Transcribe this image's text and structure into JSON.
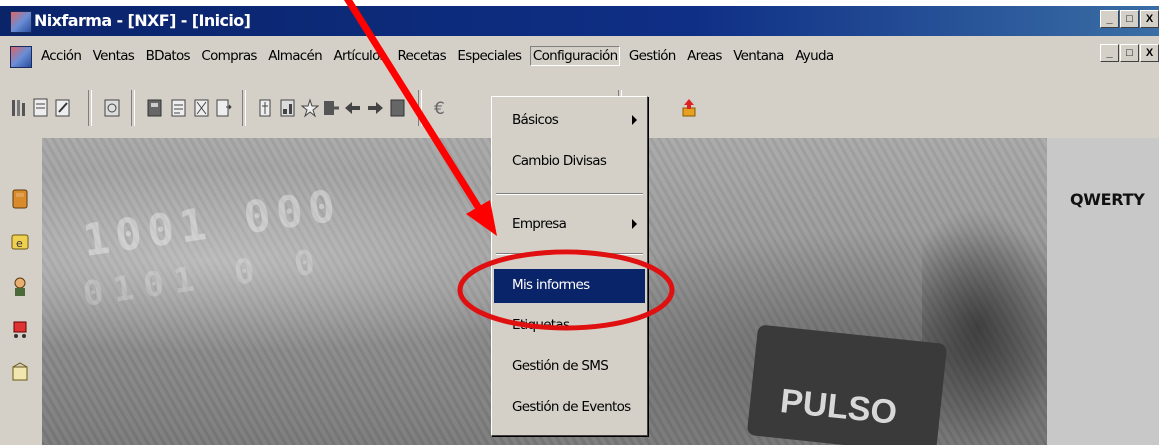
{
  "window": {
    "title": "Nixfarma - [NXF] - [Inicio]",
    "controls": [
      "_",
      "□",
      "X"
    ]
  },
  "menubar": {
    "items": [
      {
        "label": "Acción"
      },
      {
        "label": "Ventas"
      },
      {
        "label": "BDatos"
      },
      {
        "label": "Compras"
      },
      {
        "label": "Almacén"
      },
      {
        "label": "Artículos"
      },
      {
        "label": "Recetas"
      },
      {
        "label": "Especiales"
      },
      {
        "label": "Configuración",
        "active": true
      },
      {
        "label": "Gestión"
      },
      {
        "label": "Areas"
      },
      {
        "label": "Ventana"
      },
      {
        "label": "Ayuda"
      }
    ],
    "mdi_controls": [
      "_",
      "□",
      "X"
    ]
  },
  "toolbar": {
    "icons": [
      "toolbar-icon-1",
      "toolbar-icon-2",
      "toolbar-icon-3",
      "toolbar-icon-4",
      "toolbar-icon-5",
      "toolbar-icon-6",
      "toolbar-icon-7",
      "toolbar-icon-8",
      "toolbar-icon-9",
      "toolbar-icon-10",
      "star-icon",
      "toolbar-icon-12",
      "left-arrow-icon",
      "right-arrow-icon",
      "toolbar-icon-15",
      "euro-icon",
      "help-icon",
      "upload-icon"
    ]
  },
  "sidebar": {
    "icons": [
      "ticket-icon",
      "money-icon",
      "user-icon",
      "cart-icon",
      "package-icon"
    ]
  },
  "dropdown": {
    "items": [
      {
        "label": "Básicos",
        "submenu": true
      },
      {
        "label": "Cambio Divisas",
        "submenu": false
      },
      {
        "label": "Empresa",
        "submenu": true
      },
      {
        "label": "Mis informes",
        "selected": true
      },
      {
        "label": "Etiquetas"
      },
      {
        "label": "Gestión de SMS"
      },
      {
        "label": "Gestión de Eventos"
      }
    ]
  },
  "background": {
    "company_label": "QWERTY",
    "device_label": "PULSO",
    "digits_line1": "1001 000",
    "digits_line2": "0101 0 0"
  },
  "annotation": {
    "arrow_color": "#ff0000",
    "circle_color": "#e01010"
  }
}
